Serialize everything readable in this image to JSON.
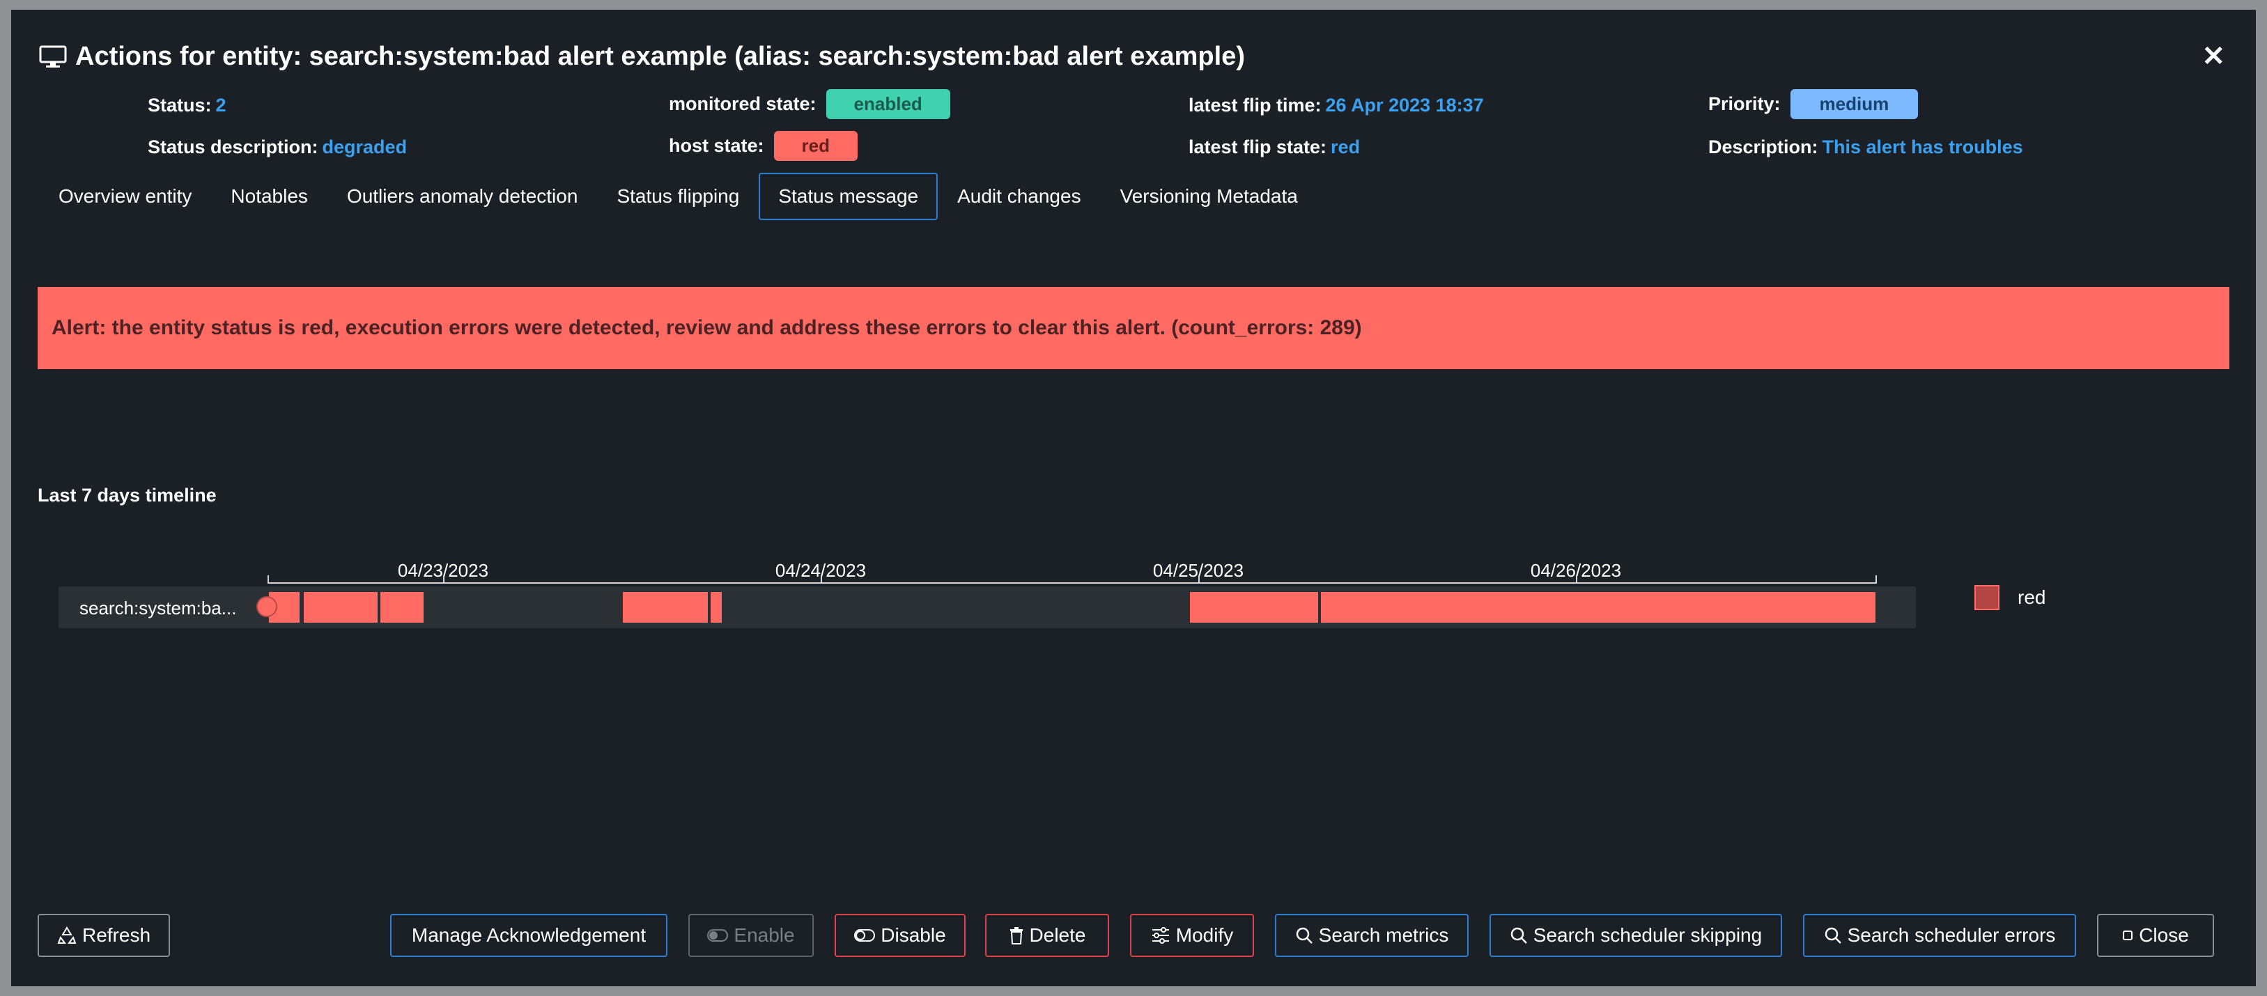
{
  "header": {
    "title": "Actions for entity: search:system:bad alert example (alias: search:system:bad alert example)",
    "close_symbol": "✕"
  },
  "meta": {
    "status_label": "Status:",
    "status_value": "2",
    "status_desc_label": "Status description:",
    "status_desc_value": "degraded",
    "monitored_label": "monitored state:",
    "monitored_value": "enabled",
    "host_label": "host state:",
    "host_value": "red",
    "flip_time_label": "latest flip time:",
    "flip_time_value": "26 Apr 2023 18:37",
    "flip_state_label": "latest flip state:",
    "flip_state_value": "red",
    "priority_label": "Priority:",
    "priority_value": "medium",
    "description_label": "Description:",
    "description_value": "This alert has troubles"
  },
  "tabs": [
    {
      "label": "Overview entity"
    },
    {
      "label": "Notables"
    },
    {
      "label": "Outliers anomaly detection"
    },
    {
      "label": "Status flipping"
    },
    {
      "label": "Status message",
      "active": true
    },
    {
      "label": "Audit changes"
    },
    {
      "label": "Versioning Metadata"
    }
  ],
  "alert": {
    "text": "Alert: the entity status is red, execution errors were detected, review and address these errors to clear this alert. (count_errors: 289)"
  },
  "timeline": {
    "title": "Last 7 days timeline",
    "row_label": "search:system:ba...",
    "dates": [
      "04/23/2023",
      "04/24/2023",
      "04/25/2023",
      "04/26/2023"
    ],
    "legend": [
      {
        "label": "red",
        "color": "#ff6b62"
      }
    ]
  },
  "buttons": {
    "refresh": "Refresh",
    "manage_ack": "Manage Acknowledgement",
    "enable": "Enable",
    "disable": "Disable",
    "delete": "Delete",
    "modify": "Modify",
    "search_metrics": "Search metrics",
    "search_skipping": "Search scheduler skipping",
    "search_errors": "Search scheduler errors",
    "close": "Close"
  },
  "colors": {
    "background": "#1b2026",
    "accent_blue": "#3aa0f0",
    "alert_red": "#ff6b62",
    "enabled_green": "#3fd1b0",
    "medium_blue": "#7cb9ff"
  }
}
